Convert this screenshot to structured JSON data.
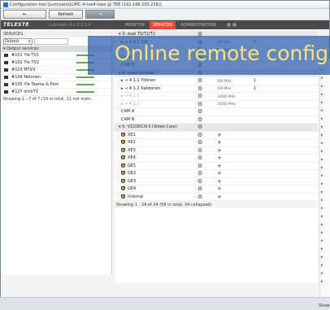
{
  "window": {
    "title": "Configuration tool [Luminato/LUMC-4-tve4-tvpo @ TRE (192.168.200.226)]"
  },
  "toolbar": {
    "back_icon": "arrow-left-icon",
    "refresh_label": "Refresh",
    "forward_icon": "arrow-right-icon"
  },
  "topbar": {
    "logo": "TELESTE",
    "product": "Luminato 4.x 3.3.1.4",
    "nav": [
      "MONITOR",
      "SERVICES",
      "ADMINISTRATION"
    ],
    "active_nav": "SERVICES"
  },
  "banner": {
    "text": "Online remote configu"
  },
  "left_panel": {
    "header": "SERVICES",
    "output_select": "Output",
    "group_label": "Output services",
    "services": [
      {
        "name": "#101 Yle TV1"
      },
      {
        "name": "#102 Yle TV2"
      },
      {
        "name": "#103 MTV3"
      },
      {
        "name": "#104 Nelonen"
      },
      {
        "name": "#105 Yle Teema & Fem"
      },
      {
        "name": "#127 ornhTV"
      }
    ],
    "footer": "Showing 1 - 7 of 7 (19 in total, 11 not matc.."
  },
  "right_panel": {
    "rows": [
      {
        "kind": "group",
        "label": "3: dual TS/T2/T2",
        "gear": true
      },
      {
        "kind": "item",
        "label": "2.1.1 1/8",
        "icon": "arrow-in-icon",
        "val": "5/8 MHz",
        "num": "0",
        "muted": false
      },
      {
        "kind": "item",
        "label": "2.2.1",
        "icon": "arrow-in-icon",
        "val": "5/8 MHz",
        "num": "",
        "muted": true
      },
      {
        "kind": "sub",
        "label": "CAM A"
      },
      {
        "kind": "sub",
        "label": "CAM B"
      },
      {
        "kind": "group",
        "label": "4: quad receiver",
        "gear": true
      },
      {
        "kind": "item",
        "label": "4.1.1 Ylöinen",
        "icon": "arrow-in-icon",
        "val": "306 MHz",
        "num": "1",
        "muted": false
      },
      {
        "kind": "item",
        "label": "4.1.2 Kakkonen",
        "icon": "arrow-in-icon",
        "val": "308 MHz",
        "num": "1",
        "muted": false
      },
      {
        "kind": "item",
        "label": "4.2.1",
        "icon": "arrow-in-icon",
        "val": "10000 MHz",
        "num": "",
        "muted": true
      },
      {
        "kind": "item",
        "label": "4.2.2",
        "icon": "arrow-in-icon",
        "val": "10000 MHz",
        "num": "",
        "muted": true
      },
      {
        "kind": "sub",
        "label": "CAM A"
      },
      {
        "kind": "sub",
        "label": "CAM B"
      },
      {
        "kind": "group",
        "label": "5: V1D30C0r3 (Video Core)",
        "gear": true
      },
      {
        "kind": "core",
        "label": "XE1"
      },
      {
        "kind": "core",
        "label": "XE2"
      },
      {
        "kind": "core",
        "label": "XE3"
      },
      {
        "kind": "core",
        "label": "XE4"
      },
      {
        "kind": "core",
        "label": "GE1"
      },
      {
        "kind": "core",
        "label": "GE2"
      },
      {
        "kind": "core",
        "label": "GE3"
      },
      {
        "kind": "core",
        "label": "GE4"
      },
      {
        "kind": "core",
        "label": "Internal"
      }
    ],
    "footer": "Showing 1 - 24 of 24 (58 in total, 34 collapsed)"
  },
  "far_right": {
    "label": "Show"
  },
  "colors": {
    "accent_red": "#e94b3c",
    "banner_text": "#ffe27a",
    "status_green": "#6aa84f"
  }
}
